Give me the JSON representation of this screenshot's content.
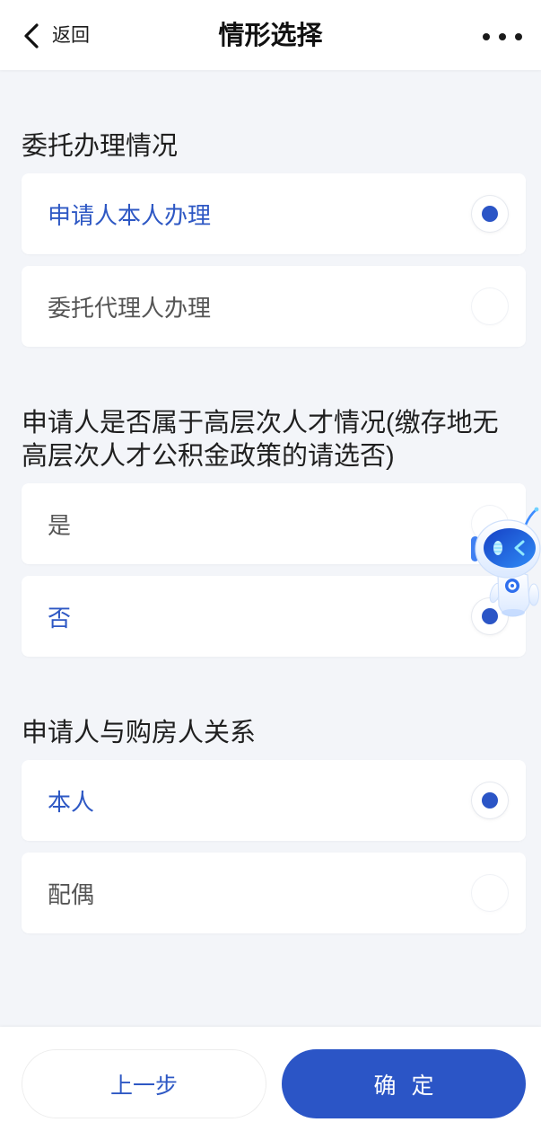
{
  "header": {
    "back_label": "返回",
    "title": "情形选择"
  },
  "sections": [
    {
      "heading": "委托办理情况",
      "options": [
        {
          "label": "申请人本人办理",
          "selected": true
        },
        {
          "label": "委托代理人办理",
          "selected": false
        }
      ]
    },
    {
      "heading": "申请人是否属于高层次人才情况(缴存地无高层次人才公积金政策的请选否)",
      "options": [
        {
          "label": "是",
          "selected": false
        },
        {
          "label": "否",
          "selected": true
        }
      ]
    },
    {
      "heading": "申请人与购房人关系",
      "options": [
        {
          "label": "本人",
          "selected": true
        },
        {
          "label": "配偶",
          "selected": false
        }
      ]
    }
  ],
  "footer": {
    "prev_label": "上一步",
    "confirm_label": "确 定"
  },
  "icons": {
    "back": "chevron-left-icon",
    "more": "more-dots-icon",
    "assistant": "robot-assistant-icon",
    "radio": "radio-button"
  },
  "colors": {
    "accent": "#2b55c6",
    "selected_text": "#2e58c4",
    "unselected_text": "#555555",
    "page_background": "#f3f5f9"
  }
}
